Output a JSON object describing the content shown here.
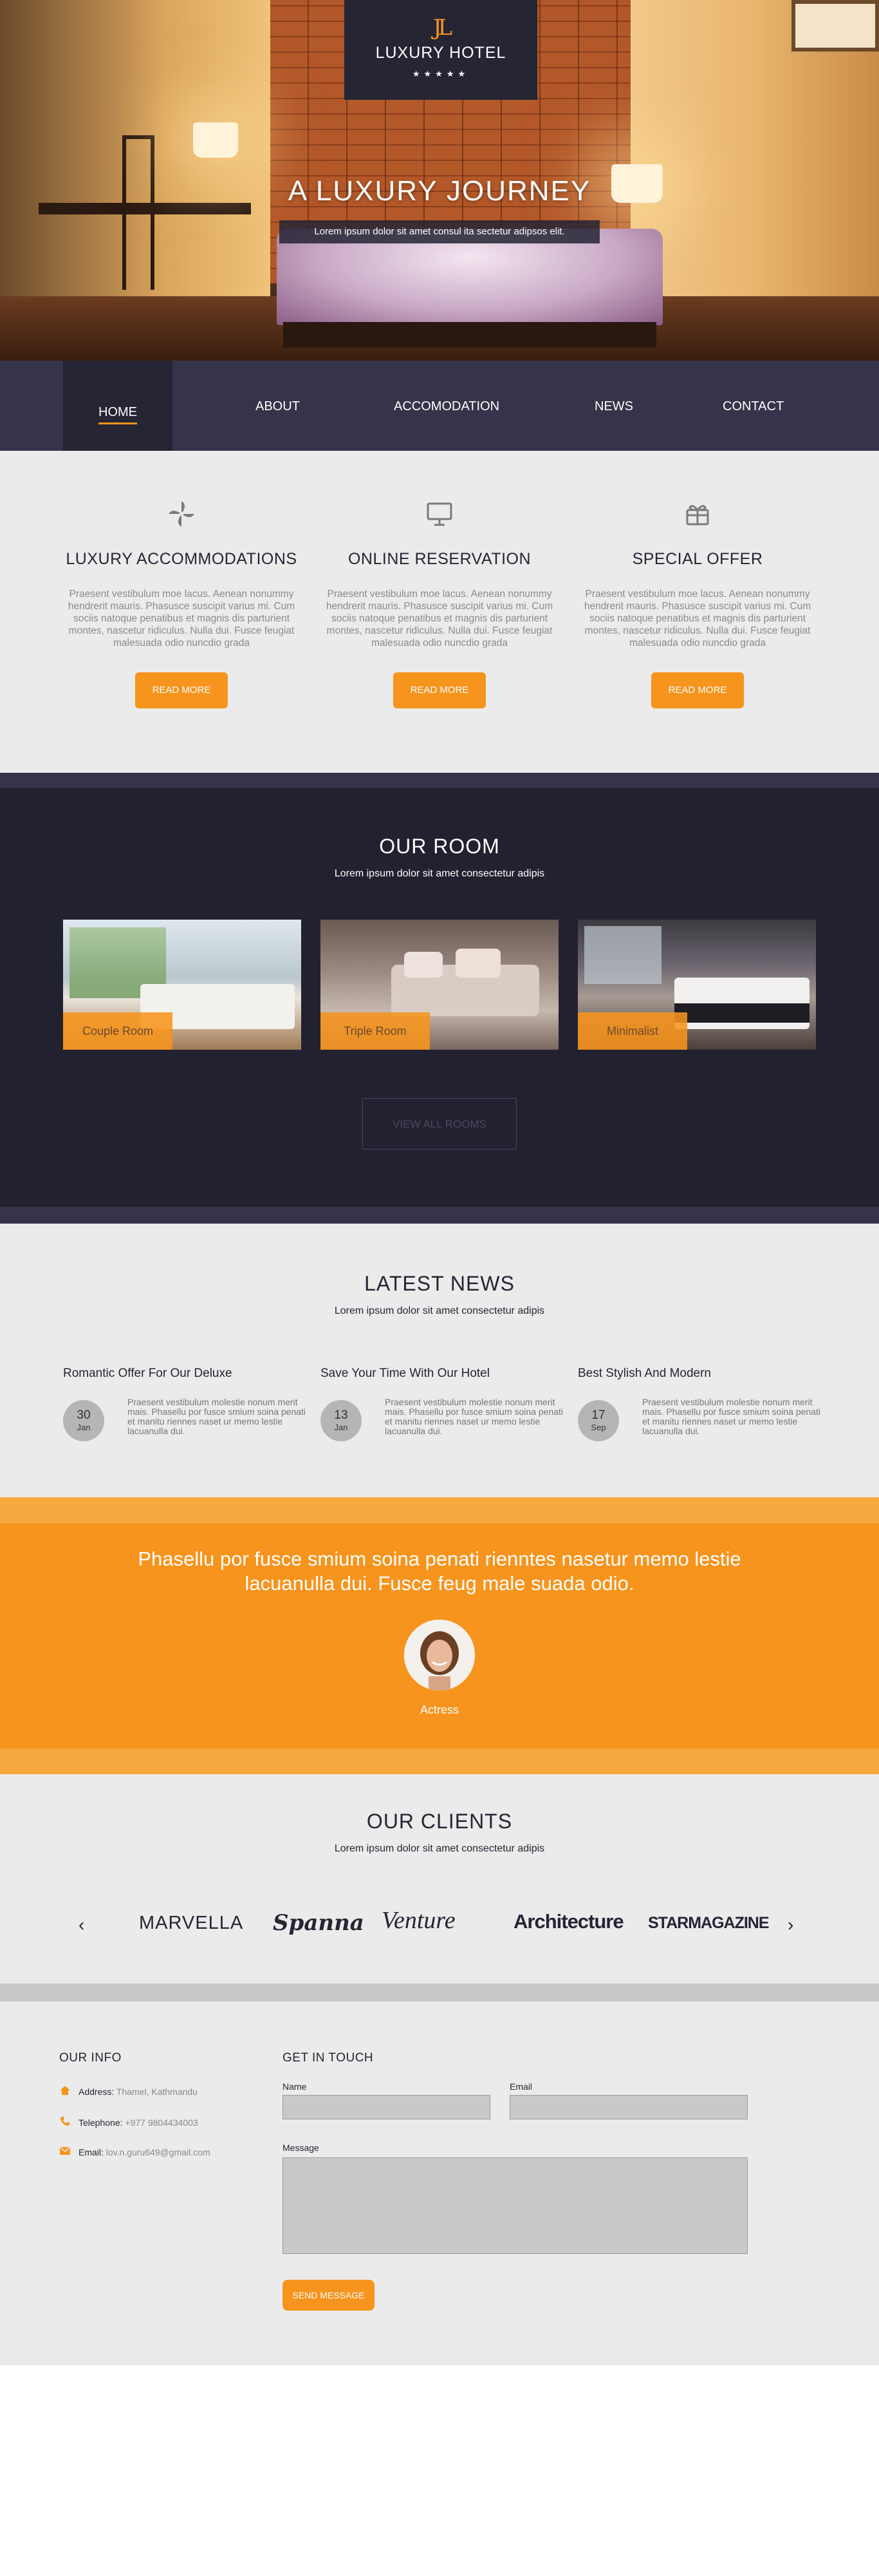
{
  "brand": {
    "mark": "JL",
    "name": "LUXURY HOTEL",
    "stars": "★★★★★"
  },
  "hero": {
    "title": "A LUXURY JOURNEY",
    "subtitle": "Lorem ipsum dolor sit amet consul ita sectetur adipsos elit."
  },
  "nav": {
    "items": [
      "HOME",
      "ABOUT",
      "ACCOMODATION",
      "NEWS",
      "CONTACT"
    ],
    "active": "HOME"
  },
  "features": [
    {
      "icon": "pinwheel-icon",
      "title": "LUXURY ACCOMMODATIONS",
      "text": "Praesent vestibulum moe lacus. Aenean nonummy hendrerit mauris. Phasusce suscipit varius mi. Cum sociis natoque penatibus et magnis dis parturient montes, nascetur ridiculus. Nulla dui. Fusce feugiat malesuada odio nuncdio grada",
      "button": "READ MORE"
    },
    {
      "icon": "monitor-icon",
      "title": "ONLINE RESERVATION",
      "text": "Praesent vestibulum moe lacus. Aenean nonummy hendrerit mauris. Phasusce suscipit varius mi. Cum sociis natoque penatibus et magnis dis parturient montes, nascetur ridiculus. Nulla dui. Fusce feugiat malesuada odio nuncdio grada",
      "button": "READ MORE"
    },
    {
      "icon": "gift-icon",
      "title": "SPECIAL OFFER",
      "text": "Praesent vestibulum moe lacus. Aenean nonummy hendrerit mauris. Phasusce suscipit varius mi. Cum sociis natoque penatibus et magnis dis parturient montes, nascetur ridiculus. Nulla dui. Fusce feugiat malesuada odio nuncdio grada",
      "button": "READ MORE"
    }
  ],
  "rooms": {
    "title": "OUR ROOM",
    "subtitle": "Lorem ipsum dolor sit amet consectetur adipis",
    "items": [
      {
        "label": "Couple Room"
      },
      {
        "label": "Triple Room"
      },
      {
        "label": "Minimalist"
      }
    ],
    "view_all": "VIEW ALL ROOMS"
  },
  "news": {
    "title": "LATEST NEWS",
    "subtitle": "Lorem ipsum dolor sit amet consectetur adipis",
    "items": [
      {
        "title": "Romantic Offer For Our Deluxe",
        "day": "30",
        "month": "Jan",
        "text": "Praesent vestibulum molestie nonum merit mais. Phasellu por fusce smium soina penati et manitu riennes naset ur memo lestie lacuanulla dui."
      },
      {
        "title": "Save Your Time With Our Hotel",
        "day": "13",
        "month": "Jan",
        "text": "Praesent vestibulum molestie nonum merit mais. Phasellu por fusce smium soina penati et manitu riennes naset ur memo lestie lacuanulla dui."
      },
      {
        "title": "Best Stylish And Modern",
        "day": "17",
        "month": "Sep",
        "text": "Praesent vestibulum molestie nonum merit mais. Phasellu por fusce smium soina penati et manitu riennes naset ur memo lestie lacuanulla dui."
      }
    ]
  },
  "testimonial": {
    "quote": "Phasellu por fusce smium soina penati rienntes nasetur memo lestie lacuanulla dui. Fusce feug male suada odio.",
    "author": "Actress"
  },
  "clients": {
    "title": "OUR CLIENTS",
    "subtitle": "Lorem ipsum dolor sit amet consectetur adipis",
    "logos": [
      "MARVELLA",
      "Spanna",
      "Venture",
      "Architecture",
      "STARMAGAZINE"
    ],
    "prev": "‹",
    "next": "›"
  },
  "footer": {
    "info_title": "OUR INFO",
    "address_label": "Address:",
    "address": "Thamel, Kathmandu",
    "phone_label": "Telephone:",
    "phone": "+977 9804434003",
    "email_label": "Email:",
    "email": "lov.n.guru649@gmail.com",
    "contact_title": "GET IN TOUCH",
    "name_label": "Name",
    "email_field_label": "Email",
    "message_label": "Message",
    "send": "SEND MESSAGE"
  },
  "colors": {
    "accent": "#f7941d",
    "dark": "#252534",
    "nav": "#36344a",
    "light_bg": "#ebebeb"
  }
}
